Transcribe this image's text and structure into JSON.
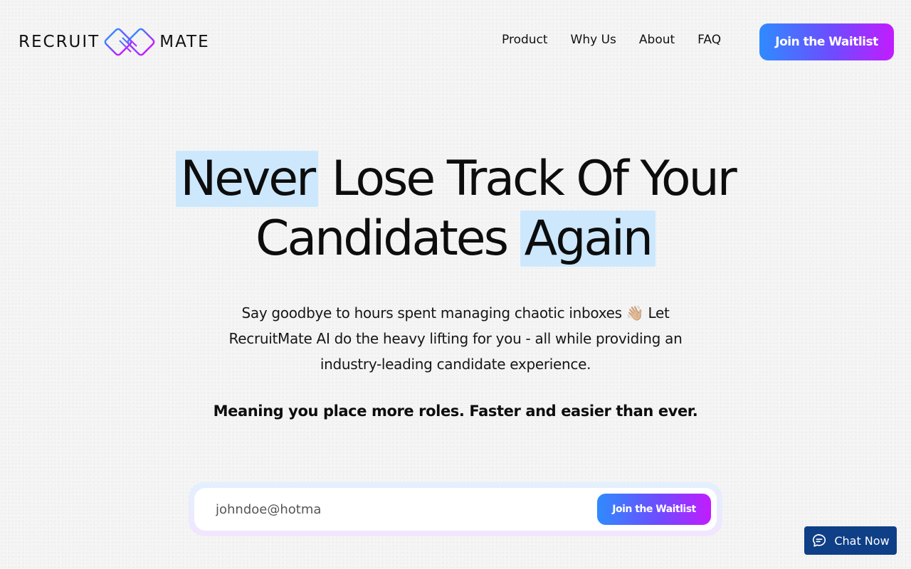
{
  "brand": {
    "left_text": "RECRUIT",
    "right_text": "MATE",
    "icon": "interlocked-squares-logo-icon",
    "gradient_start": "#2f8bff",
    "gradient_end": "#c21cff"
  },
  "nav": {
    "items": [
      {
        "label": "Product"
      },
      {
        "label": "Why Us"
      },
      {
        "label": "About"
      },
      {
        "label": "FAQ"
      }
    ],
    "cta_label": "Join the Waitlist"
  },
  "hero": {
    "title_word1": "Never",
    "title_middle": "Lose Track Of Your",
    "title_word3": "Candidates",
    "title_word4": "Again",
    "highlight_color": "#cde8fd",
    "subtitle": "Say goodbye to hours spent managing chaotic inboxes 👋🏼 Let RecruitMate AI do the heavy lifting for you - all while providing an industry-leading candidate experience.",
    "tagline": "Meaning you place more roles. Faster and easier than ever."
  },
  "waitlist_form": {
    "email_value": "johndoe@hotma",
    "button_label": "Join the Waitlist"
  },
  "chat": {
    "label": "Chat Now",
    "icon": "chat-bubble-icon",
    "color": "#0f3f86"
  }
}
